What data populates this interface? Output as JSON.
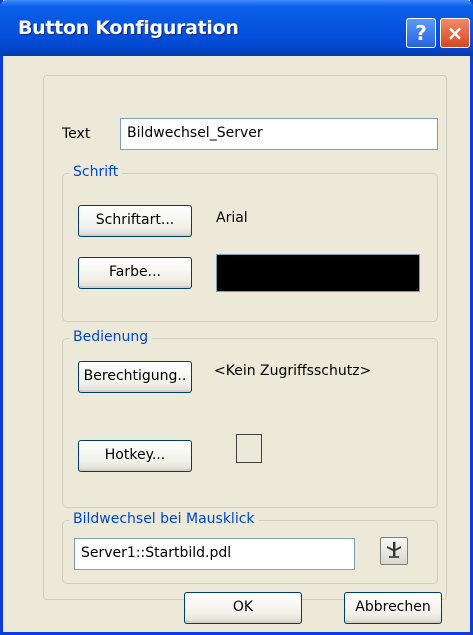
{
  "window": {
    "title": "Button Konfiguration",
    "help_label": "?",
    "close_label": "×"
  },
  "text_field": {
    "label": "Text",
    "value": "Bildwechsel_Server"
  },
  "schrift": {
    "title": "Schrift",
    "font_button_label": "Schriftart...",
    "font_value": "Arial",
    "color_button_label": "Farbe...",
    "color_value": "#000000"
  },
  "bedienung": {
    "title": "Bedienung",
    "permission_button_label": "Berechtigung..",
    "permission_value": "<Kein Zugriffsschutz>",
    "hotkey_button_label": "Hotkey..."
  },
  "bildwechsel": {
    "title": "Bildwechsel bei Mausklick",
    "value": "Server1::Startbild.pdl"
  },
  "footer": {
    "ok_label": "OK",
    "cancel_label": "Abbrechen"
  }
}
